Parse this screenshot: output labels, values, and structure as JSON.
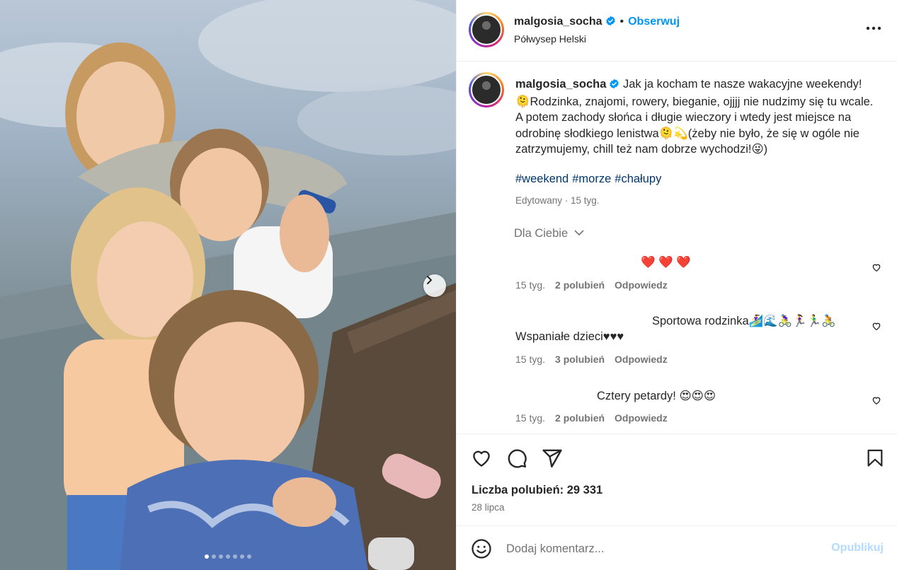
{
  "post": {
    "username": "malgosia_socha",
    "follow_label": "Obserwuj",
    "location": "Półwysep Helski",
    "caption": "Jak ja kocham te nasze wakacyjne weekendy! 🫠Rodzinka, znajomi, rowery, bieganie, ojjjj nie nudzimy się tu wcale. A potem zachody słońca i długie wieczory i wtedy jest miejsce na odrobinę słodkiego lenistwa🫠💫(żeby nie było, że się w ogóle nie zatrzymujemy, chill też nam dobrze wychodzi!😜)",
    "hashtags": [
      "#weekend",
      "#morze",
      "#chałupy"
    ],
    "edited_label": "Edytowany · 15 tyg.",
    "for_you_label": "Dla Ciebie"
  },
  "comments": [
    {
      "text": "❤️ ❤️ ❤️",
      "time": "15 tyg.",
      "likes": "2 polubień",
      "reply": "Odpowiedz"
    },
    {
      "text_line1": "Sportowa rodzinka🏄‍♀️🌊🚴‍♀️🏃‍♀️🏃‍♂️🚴",
      "text_line2": "Wspaniałe dzieci♥♥♥",
      "time": "15 tyg.",
      "likes": "3 polubień",
      "reply": "Odpowiedz"
    },
    {
      "text": "Cztery petardy! 😍😍😍",
      "time": "15 tyg.",
      "likes": "2 polubień",
      "reply": "Odpowiedz"
    }
  ],
  "actions": {
    "icons": [
      "heart-icon",
      "comment-icon",
      "share-icon",
      "bookmark-icon"
    ],
    "likes_label": "Liczba polubień: 29 331",
    "date": "28 lipca"
  },
  "comment_input": {
    "placeholder": "Dodaj komentarz...",
    "publish_label": "Opublikuj"
  },
  "carousel": {
    "slide_count": 7,
    "active_slide": 1
  },
  "colors": {
    "accent": "#0095f6",
    "hashtag": "#00376b",
    "muted": "#737373",
    "publish_disabled": "#b3dbff"
  }
}
